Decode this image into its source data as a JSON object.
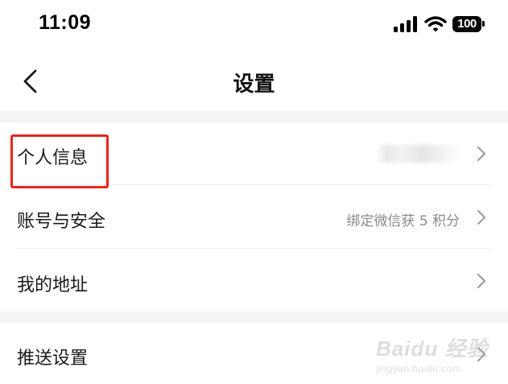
{
  "status_bar": {
    "time": "11:09",
    "battery": "100"
  },
  "nav": {
    "title": "设置"
  },
  "settings": {
    "items": [
      {
        "label": "个人信息",
        "value": ""
      },
      {
        "label": "账号与安全",
        "value": "绑定微信获 5 积分"
      },
      {
        "label": "我的地址",
        "value": ""
      },
      {
        "label": "推送设置",
        "value": ""
      }
    ]
  },
  "watermark": {
    "main": "Baidu 经验",
    "sub": "jingyan.baidu.com"
  },
  "colors": {
    "highlight": "#e8251c",
    "section_gap": "#f4f4f4",
    "secondary_text": "#8a8a8a"
  }
}
